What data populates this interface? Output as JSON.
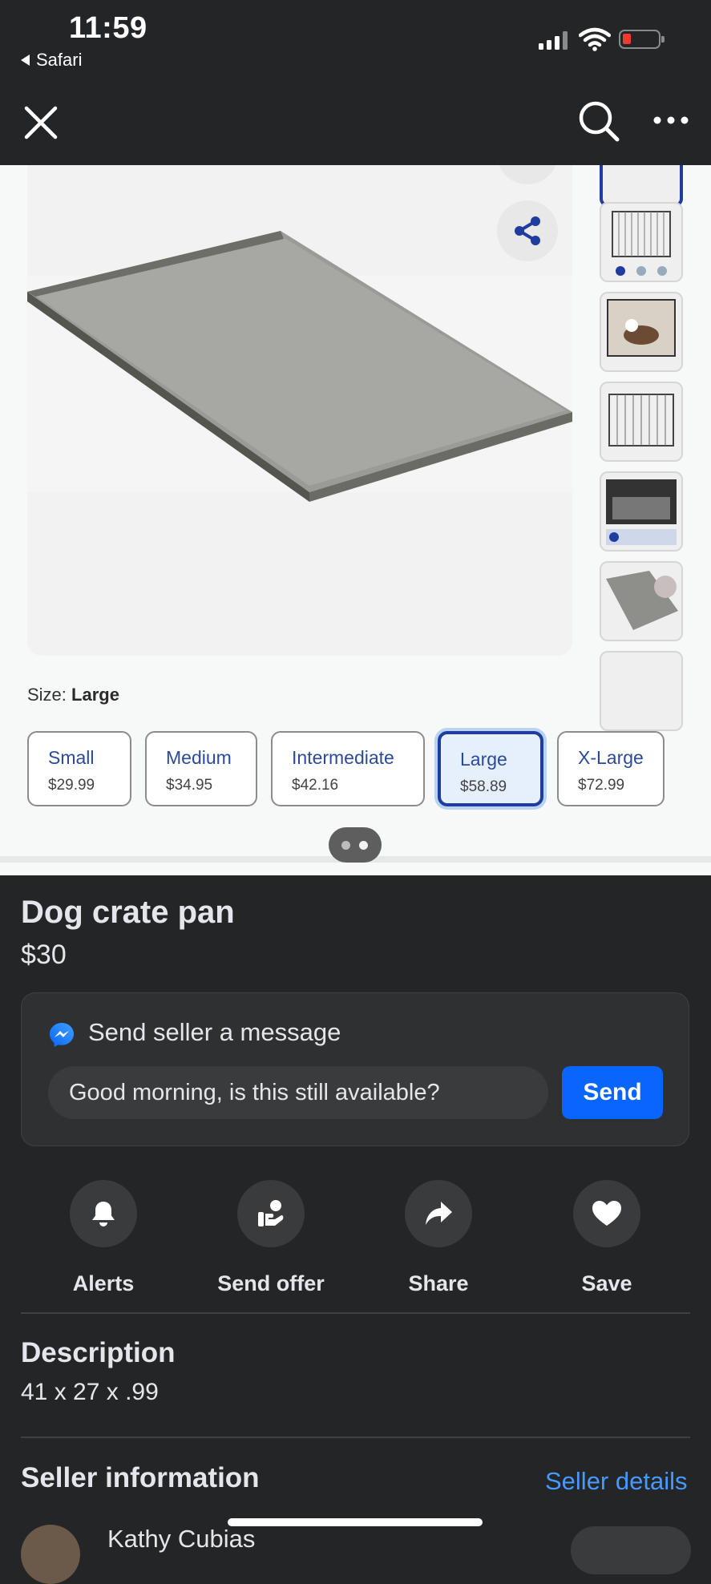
{
  "status_bar": {
    "time": "11:59",
    "back_app": "Safari",
    "battery_color": "#eb3b32"
  },
  "nav": {
    "close_icon": "close-icon",
    "search_icon": "search-icon",
    "more_icon": "more-horizontal-icon"
  },
  "product_page": {
    "size_label": "Size:",
    "size_value": "Large",
    "sizes": [
      {
        "name": "Small",
        "price": "$29.99"
      },
      {
        "name": "Medium",
        "price": "$34.95"
      },
      {
        "name": "Intermediate",
        "price": "$42.16"
      },
      {
        "name": "Large",
        "price": "$58.89"
      },
      {
        "name": "X-Large",
        "price": "$72.99"
      }
    ],
    "selected_size": "Large",
    "accent": "#1f3c9e"
  },
  "listing": {
    "title": "Dog crate pan",
    "price": "$30"
  },
  "message": {
    "title": "Send seller a message",
    "input_value": "Good morning, is this still available?",
    "send_label": "Send",
    "send_color": "#0866ff"
  },
  "actions": [
    {
      "label": "Alerts",
      "icon": "bell-icon"
    },
    {
      "label": "Send offer",
      "icon": "offer-hand-icon"
    },
    {
      "label": "Share",
      "icon": "share-arrow-icon"
    },
    {
      "label": "Save",
      "icon": "heart-icon"
    }
  ],
  "description": {
    "heading": "Description",
    "text": "41 x 27 x .99"
  },
  "seller": {
    "heading": "Seller information",
    "details_link": "Seller details",
    "name": "Kathy Cubias",
    "link_color": "#4599ff"
  }
}
